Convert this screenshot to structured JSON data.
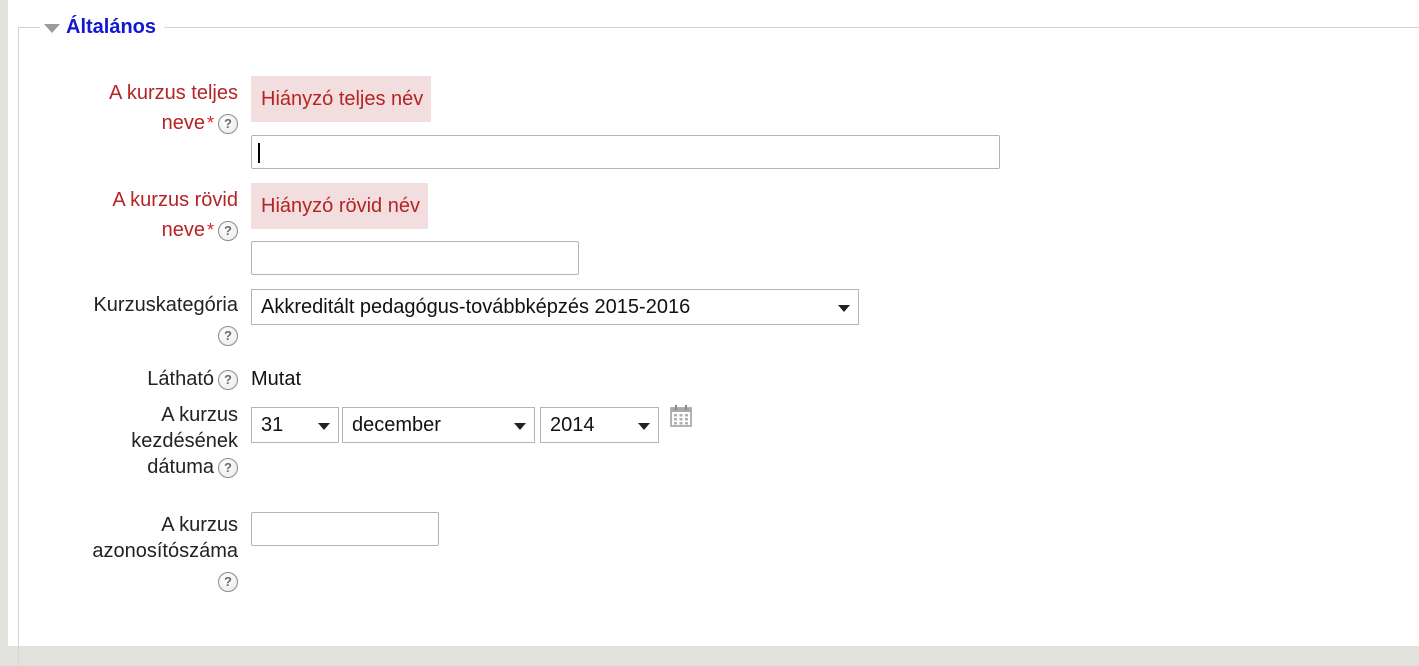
{
  "section": {
    "title": "Általános"
  },
  "fields": {
    "fullname": {
      "label_line1": "A kurzus teljes",
      "label_line2": "neve",
      "required_mark": "*",
      "error": "Hiányzó teljes név",
      "value": ""
    },
    "shortname": {
      "label_line1": "A kurzus rövid",
      "label_line2": "neve",
      "required_mark": "*",
      "error": "Hiányzó rövid név",
      "value": ""
    },
    "category": {
      "label": "Kurzuskategória",
      "selected": "Akkreditált pedagógus-továbbképzés 2015-2016"
    },
    "visible": {
      "label": "Látható",
      "value": "Mutat"
    },
    "startdate": {
      "label_line1": "A kurzus",
      "label_line2": "kezdésének",
      "label_line3": "dátuma",
      "day": "31",
      "month": "december",
      "year": "2014"
    },
    "idnumber": {
      "label_line1": "A kurzus",
      "label_line2": "azonosítószáma",
      "value": ""
    }
  },
  "help_glyph": "?",
  "icons": {
    "help": "help-icon",
    "calendar": "calendar-icon",
    "collapse": "triangle-down-icon"
  },
  "colors": {
    "legend": "#1117d3",
    "error_text": "#b52424",
    "error_bg": "#f2dede",
    "required": "#e02020"
  }
}
